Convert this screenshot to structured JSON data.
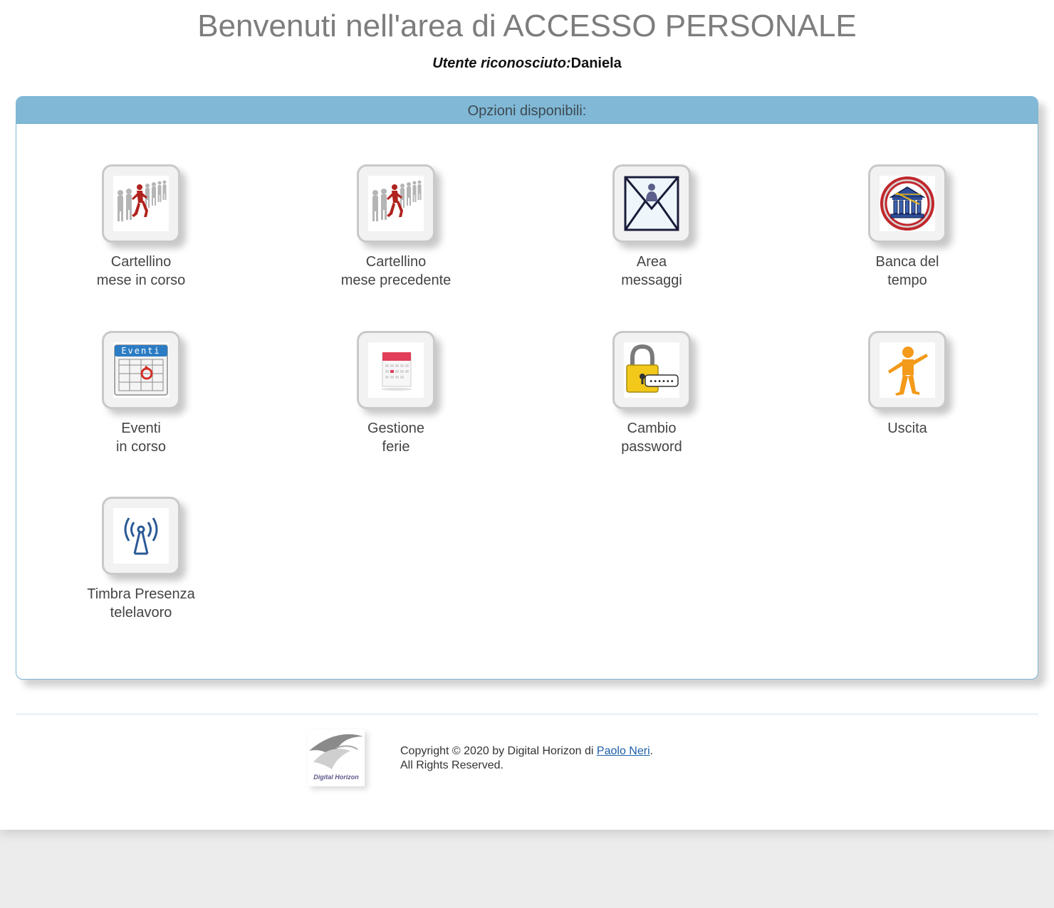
{
  "header": {
    "title": "Benvenuti nell'area di ACCESSO PERSONALE",
    "user_label": "Utente riconosciuto:",
    "user_name": "Daniela"
  },
  "panel": {
    "title": "Opzioni disponibili:",
    "accent_color": "#80b8d6"
  },
  "tiles": [
    {
      "icon": "runners-icon",
      "line1": "Cartellino",
      "line2": "mese in corso"
    },
    {
      "icon": "runners-icon",
      "line1": "Cartellino",
      "line2": "mese precedente"
    },
    {
      "icon": "envelope-icon",
      "line1": "Area",
      "line2": "messaggi"
    },
    {
      "icon": "bank-icon",
      "line1": "Banca del",
      "line2": "tempo"
    },
    {
      "icon": "calendar-events-icon",
      "line1": "Eventi",
      "line2": "in corso",
      "icon_text": "Eventi"
    },
    {
      "icon": "calendar-icon",
      "line1": "Gestione",
      "line2": "ferie"
    },
    {
      "icon": "padlock-icon",
      "line1": "Cambio",
      "line2": "password",
      "icon_text": "••••••"
    },
    {
      "icon": "person-icon",
      "line1": "Uscita",
      "line2": ""
    },
    {
      "icon": "antenna-icon",
      "line1": "Timbra Presenza",
      "line2": "telelavoro"
    }
  ],
  "footer": {
    "logo_text": "Digital Horizon",
    "copyright_prefix": "Copyright © 2020 by Digital Horizon di ",
    "author_link": "Paolo Neri",
    "copyright_suffix": ".",
    "rights": "All Rights Reserved."
  }
}
